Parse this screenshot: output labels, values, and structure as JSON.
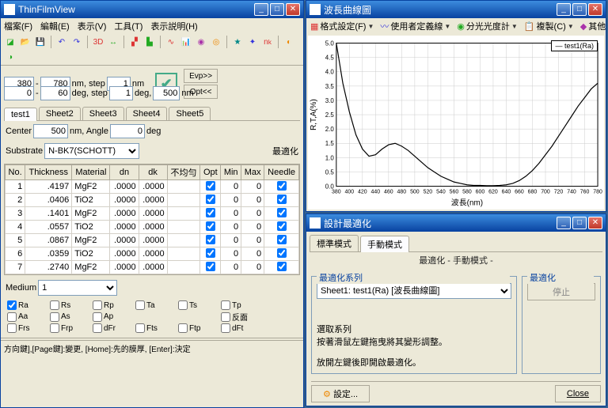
{
  "main_window": {
    "title": "ThinFilmView",
    "menu": [
      "檔案(F)",
      "編輯(E)",
      "表示(V)",
      "工具(T)",
      "表示説明(H)"
    ],
    "toolbar_icons": [
      "new",
      "open",
      "save",
      "sep",
      "undo",
      "redo",
      "sep",
      "3D",
      "sep",
      "chart-red",
      "chart-grn",
      "sep",
      "chart-line",
      "chart-bar",
      "plot-b",
      "plot-o",
      "sep",
      "cfg-a",
      "cfg-b",
      "n-k",
      "sep",
      "tool1",
      "tool2"
    ],
    "range": {
      "wl_from": "380",
      "wl_to": "780",
      "wl_unit": "nm, step",
      "wl_step": "1",
      "wl_step_unit": "nm",
      "ang_from": "0",
      "ang_to": "60",
      "ang_unit": "deg, step",
      "ang_step": "1",
      "ang_step_unit": "deg,",
      "design_wl": "500",
      "design_unit": "nm",
      "evp": "Evp>>",
      "opt": "Opt<<"
    },
    "sheet_tabs": [
      "test1",
      "Sheet2",
      "Sheet3",
      "Sheet4",
      "Sheet5"
    ],
    "center": {
      "label": "Center",
      "value": "500",
      "unit": "nm, Angle",
      "angle": "0",
      "angle_unit": "deg"
    },
    "substrate": {
      "label": "Substrate",
      "value": "N-BK7(SCHOTT)",
      "opt_label": "最適化"
    },
    "table": {
      "headers": [
        "No.",
        "Thickness",
        "Material",
        "dn",
        "dk",
        "不均勻",
        "Opt",
        "Min",
        "Max",
        "Needle"
      ],
      "rows": [
        {
          "no": "1",
          "th": ".4197",
          "mat": "MgF2",
          "dn": ".0000",
          "dk": ".0000",
          "nu": "",
          "opt": true,
          "min": "0",
          "max": "0",
          "needle": true
        },
        {
          "no": "2",
          "th": ".0406",
          "mat": "TiO2",
          "dn": ".0000",
          "dk": ".0000",
          "nu": "",
          "opt": true,
          "min": "0",
          "max": "0",
          "needle": true
        },
        {
          "no": "3",
          "th": ".1401",
          "mat": "MgF2",
          "dn": ".0000",
          "dk": ".0000",
          "nu": "",
          "opt": true,
          "min": "0",
          "max": "0",
          "needle": true
        },
        {
          "no": "4",
          "th": ".0557",
          "mat": "TiO2",
          "dn": ".0000",
          "dk": ".0000",
          "nu": "",
          "opt": true,
          "min": "0",
          "max": "0",
          "needle": true
        },
        {
          "no": "5",
          "th": ".0867",
          "mat": "MgF2",
          "dn": ".0000",
          "dk": ".0000",
          "nu": "",
          "opt": true,
          "min": "0",
          "max": "0",
          "needle": true
        },
        {
          "no": "6",
          "th": ".0359",
          "mat": "TiO2",
          "dn": ".0000",
          "dk": ".0000",
          "nu": "",
          "opt": true,
          "min": "0",
          "max": "0",
          "needle": true
        },
        {
          "no": "7",
          "th": ".2740",
          "mat": "MgF2",
          "dn": ".0000",
          "dk": ".0000",
          "nu": "",
          "opt": true,
          "min": "0",
          "max": "0",
          "needle": true
        }
      ]
    },
    "medium": {
      "label": "Medium",
      "value": "1"
    },
    "checkrows": [
      [
        [
          "Ra",
          true
        ],
        [
          "Rs",
          false
        ],
        [
          "Rp",
          false
        ],
        [
          "Ta",
          false
        ],
        [
          "Ts",
          false
        ],
        [
          "Tp",
          false
        ]
      ],
      [
        [
          "Aa",
          false
        ],
        [
          "As",
          false
        ],
        [
          "Ap",
          false
        ],
        [
          "",
          "blank"
        ],
        [
          "",
          "blank"
        ],
        [
          "反面",
          false
        ]
      ],
      [
        [
          "Frs",
          false
        ],
        [
          "Frp",
          false
        ],
        [
          "dFr",
          false
        ],
        [
          "Fts",
          false
        ],
        [
          "Ftp",
          false
        ],
        [
          "dFt",
          false
        ]
      ]
    ],
    "status": "方向鍵],[Page鍵]:變更, [Home]:先的膜厚, [Enter]:決定"
  },
  "chart_window": {
    "title": "波長曲線圖",
    "toolbar": [
      {
        "icon": "fmt",
        "label": "格式設定(F)"
      },
      {
        "icon": "usr",
        "label": "使用者定義線"
      },
      {
        "icon": "spec",
        "label": "分光光度計"
      },
      {
        "icon": "copy",
        "label": "複製(C)"
      },
      {
        "icon": "oth",
        "label": "其他"
      }
    ],
    "legend": "test1(Ra)"
  },
  "chart_data": {
    "type": "line",
    "title": "",
    "xlabel": "波長(nm)",
    "ylabel": "R,T,A(%)",
    "xlim": [
      380,
      780
    ],
    "ylim": [
      0,
      5.0
    ],
    "xticks": [
      380,
      400,
      420,
      440,
      460,
      480,
      500,
      520,
      540,
      560,
      580,
      600,
      620,
      640,
      660,
      680,
      700,
      720,
      740,
      760,
      780
    ],
    "yticks": [
      0,
      0.5,
      1.0,
      1.5,
      2.0,
      2.5,
      3.0,
      3.5,
      4.0,
      4.5,
      5.0
    ],
    "series": [
      {
        "name": "test1(Ra)",
        "x": [
          380,
          390,
          400,
          410,
          420,
          430,
          440,
          450,
          460,
          470,
          480,
          490,
          500,
          510,
          520,
          530,
          540,
          550,
          560,
          570,
          580,
          590,
          600,
          610,
          620,
          630,
          640,
          650,
          660,
          670,
          680,
          690,
          700,
          710,
          720,
          730,
          740,
          750,
          760,
          770,
          780
        ],
        "values": [
          5.0,
          3.6,
          2.6,
          1.8,
          1.3,
          1.05,
          1.1,
          1.3,
          1.45,
          1.5,
          1.4,
          1.25,
          1.05,
          0.85,
          0.65,
          0.5,
          0.35,
          0.25,
          0.15,
          0.1,
          0.05,
          0.03,
          0.03,
          0.02,
          0.02,
          0.03,
          0.05,
          0.1,
          0.2,
          0.35,
          0.55,
          0.8,
          1.1,
          1.4,
          1.75,
          2.1,
          2.45,
          2.8,
          3.1,
          3.4,
          3.6
        ]
      }
    ]
  },
  "opt_window": {
    "title": "設計最適化",
    "tabs": [
      "標準模式",
      "手動模式"
    ],
    "header": "最適化 - 手動模式 -",
    "series_label": "最適化系列",
    "opt_label": "最適化",
    "series_value": "Sheet1: test1(Ra) [波長曲線圖]",
    "stop": "停止",
    "help1": "選取系列",
    "help2": "按著滑鼠左鍵拖曳將其變形調整。",
    "help3": "放開左鍵後即開啟最適化。",
    "settings": "設定...",
    "close": "Close"
  }
}
